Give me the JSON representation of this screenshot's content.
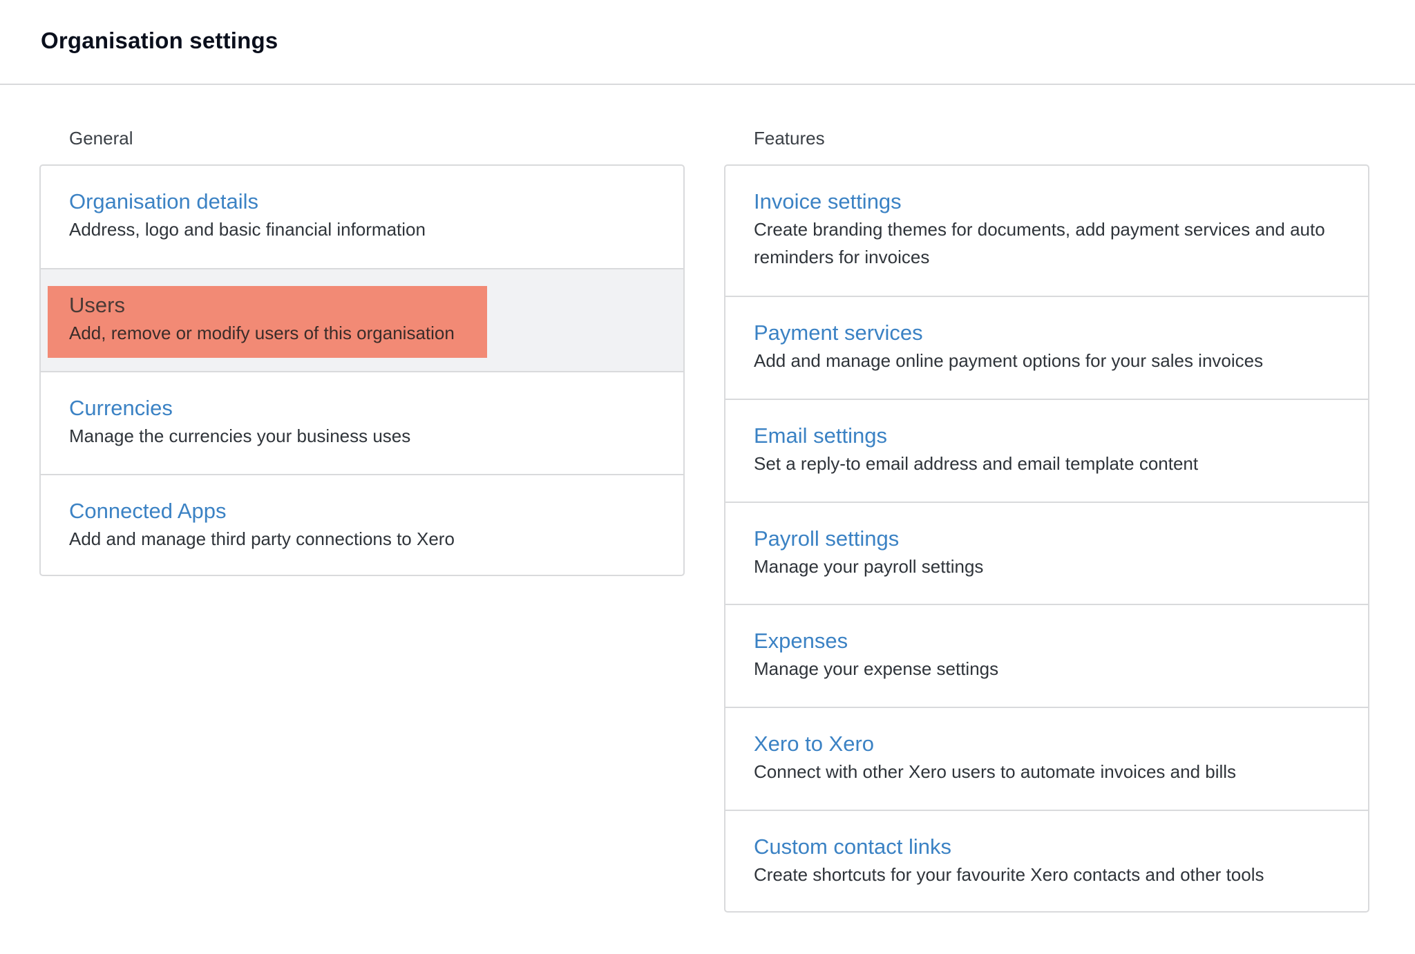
{
  "header": {
    "title": "Organisation settings"
  },
  "general": {
    "label": "General",
    "items": [
      {
        "title": "Organisation details",
        "desc": "Address, logo and basic financial information"
      },
      {
        "title": "Users",
        "desc": "Add, remove or modify users of this organisation"
      },
      {
        "title": "Currencies",
        "desc": "Manage the currencies your business uses"
      },
      {
        "title": "Connected Apps",
        "desc": "Add and manage third party connections to Xero"
      }
    ]
  },
  "features": {
    "label": "Features",
    "items": [
      {
        "title": "Invoice settings",
        "desc": "Create branding themes for documents, add payment services and auto reminders for invoices"
      },
      {
        "title": "Payment services",
        "desc": "Add and manage online payment options for your sales invoices"
      },
      {
        "title": "Email settings",
        "desc": "Set a reply-to email address and email template content"
      },
      {
        "title": "Payroll settings",
        "desc": "Manage your payroll settings"
      },
      {
        "title": "Expenses",
        "desc": "Manage your expense settings"
      },
      {
        "title": "Xero to Xero",
        "desc": "Connect with other Xero users to automate invoices and bills"
      },
      {
        "title": "Custom contact links",
        "desc": "Create shortcuts for your favourite Xero contacts and other tools"
      }
    ]
  },
  "colors": {
    "link": "#3b82c4",
    "highlight": "#f28a75",
    "hover_row": "#f1f2f4",
    "border": "#d9dadc"
  }
}
